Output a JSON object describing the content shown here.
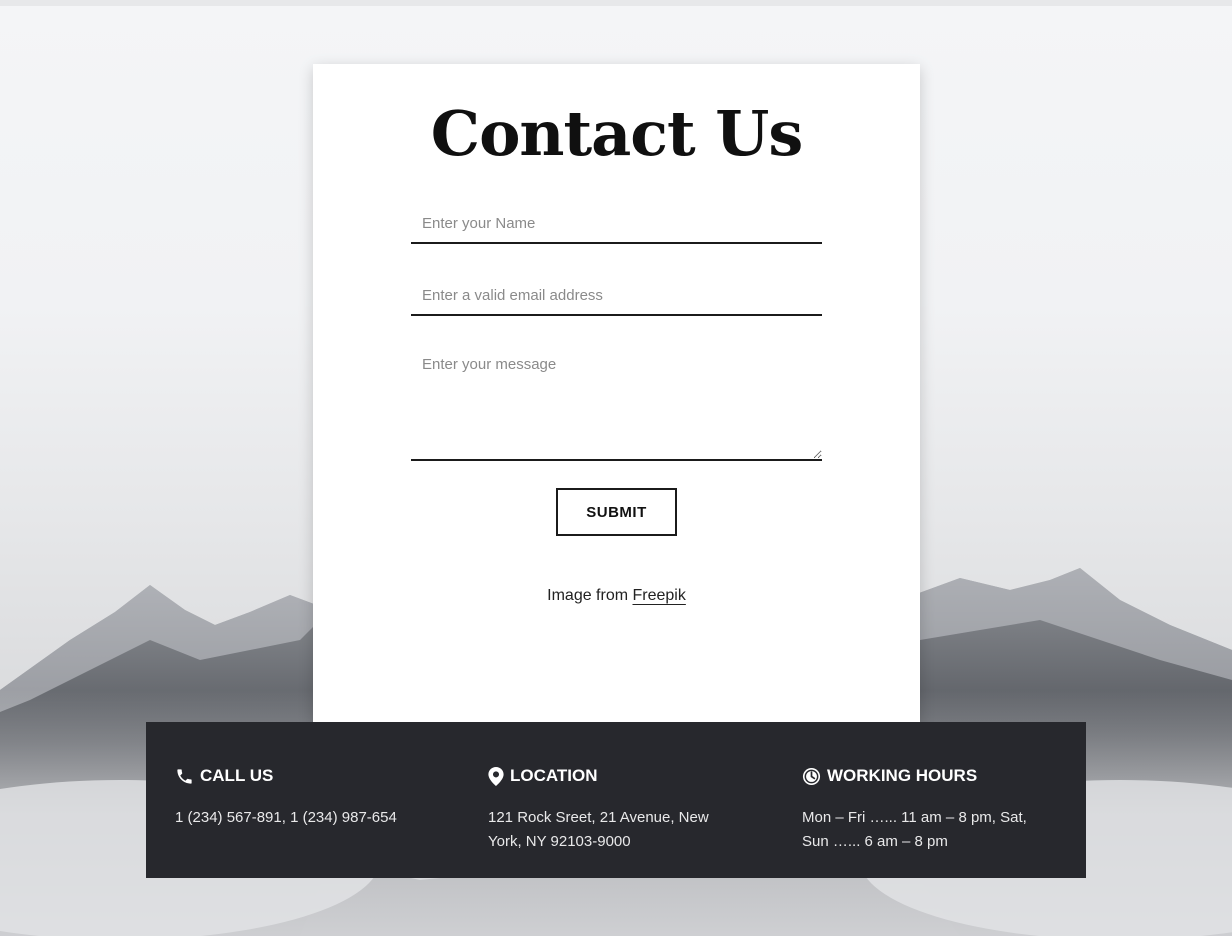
{
  "page": {
    "title": "Contact Us",
    "colors": {
      "panel": "#27282d",
      "card": "#ffffff",
      "text": "#101010"
    }
  },
  "form": {
    "name_placeholder": "Enter your Name",
    "email_placeholder": "Enter a valid email address",
    "message_placeholder": "Enter your message",
    "submit_label": "SUBMIT"
  },
  "credit": {
    "prefix": "Image from ",
    "link_text": "Freepik"
  },
  "info": {
    "call": {
      "icon": "phone-icon",
      "heading": "CALL US",
      "text": "1 (234) 567-891, 1 (234) 987-654"
    },
    "location": {
      "icon": "map-pin-icon",
      "heading": "LOCATION",
      "text": "121 Rock Sreet, 21 Avenue, New York, NY 92103-9000"
    },
    "hours": {
      "icon": "clock-icon",
      "heading": "WORKING HOURS",
      "text": "Mon – Fri …... 11 am – 8 pm, Sat, Sun  …... 6 am – 8 pm"
    }
  }
}
